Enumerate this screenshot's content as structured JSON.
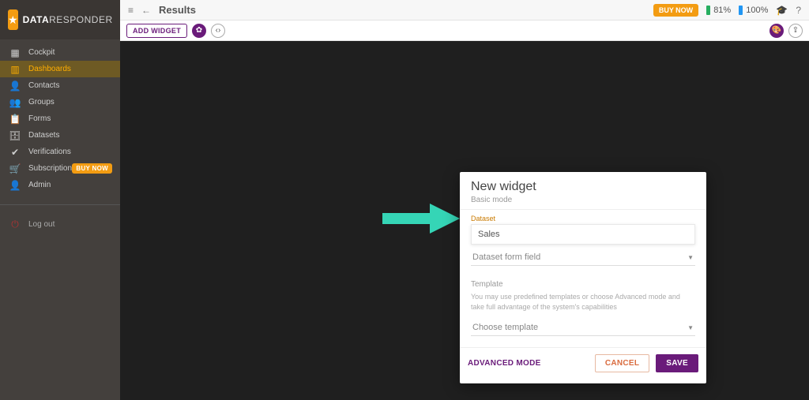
{
  "brand": {
    "strong": "DATA",
    "light": "RESPONDER"
  },
  "sidebar": {
    "items": [
      {
        "icon": "▦",
        "label": "Cockpit"
      },
      {
        "icon": "▥",
        "label": "Dashboards"
      },
      {
        "icon": "👤",
        "label": "Contacts"
      },
      {
        "icon": "👥",
        "label": "Groups"
      },
      {
        "icon": "📋",
        "label": "Forms"
      },
      {
        "icon": "🗄",
        "label": "Datasets"
      },
      {
        "icon": "✔",
        "label": "Verifications"
      },
      {
        "icon": "🛒",
        "label": "Subscription"
      },
      {
        "icon": "👤",
        "label": "Admin"
      }
    ],
    "buy_now": "BUY NOW",
    "logout": {
      "icon": "⏻",
      "label": "Log out"
    }
  },
  "topbar": {
    "title": "Results",
    "buy_now": "BUY NOW",
    "status1": "81%",
    "status2": "100%"
  },
  "toolbar": {
    "add_widget": "ADD WIDGET"
  },
  "dialog": {
    "title": "New widget",
    "subtitle": "Basic mode",
    "dataset_label": "Dataset",
    "dataset_value": "Sales",
    "form_field_placeholder": "Dataset form field",
    "template_label": "Template",
    "template_help": "You may use predefined templates or choose Advanced mode and take full advantage of the system's capabilities",
    "template_placeholder": "Choose template",
    "advanced": "ADVANCED MODE",
    "cancel": "CANCEL",
    "save": "SAVE"
  }
}
